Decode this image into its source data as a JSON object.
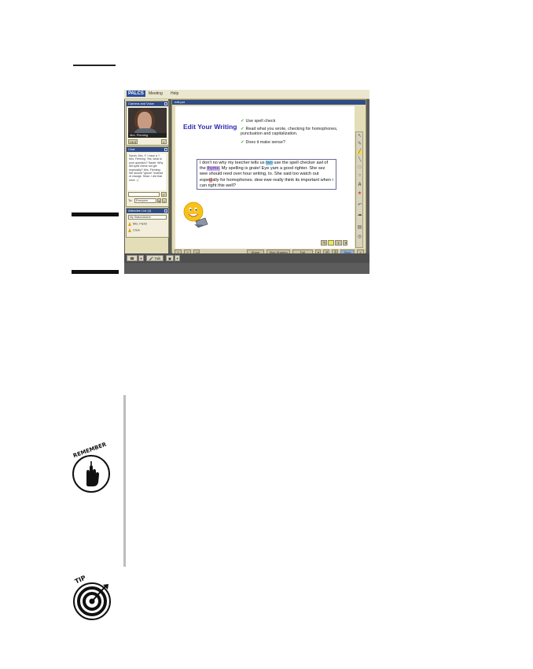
{
  "menu": {
    "logo": "PALCS",
    "items": [
      "Meeting",
      "Help"
    ]
  },
  "camera_panel": {
    "title": "Camera and Voice",
    "caption": "Mrs. Fleming",
    "btn": "Hit 8"
  },
  "chat_panel": {
    "title": "Chat",
    "messages": "Sarah: Mrs. F, I have a ? Mrs. Fleming: Yes, what is your question? Sarah: Why did spell check not get especially? Mrs. Fleming: We should \"ignore\" instead of change. Sean: I did that once :-)",
    "to_label": "To:",
    "to_value": "Everyone"
  },
  "attendee_panel": {
    "title": "Attendee List (4)",
    "select_value": "My Status/Active",
    "rows": [
      "Mrs. Flemi",
      "Crew"
    ]
  },
  "whiteboard": {
    "title": "edit.pst",
    "heading": "Edit Your Writing",
    "checklist": [
      "Use spell check",
      "Read what you wrote, checking for homophones, punctuation and capitalization.",
      "Does it make sense?"
    ],
    "sample": {
      "part1": "I don't no why my teecher tells us ",
      "hl1": "two",
      "part2": " use the spell checker awl of the ",
      "hl2": "thyme.",
      "part3": " My spelling is grate! Eye yam a good righter. She sez wee should reed over hour writing, to. She said too watch out espe",
      "hl3": "ci",
      "part4": "ally for homophones. dew ewe really think its important when i can right this well?"
    },
    "tool_labels": [
      "↖",
      "✎",
      "╱",
      "╲",
      "□",
      "○",
      "A",
      "★",
      "↶",
      "☁",
      "▤",
      "◎"
    ],
    "bottom_buttons": [
      "Share",
      "Stop Sharing",
      "Full Screen",
      "Sync"
    ],
    "page_value": "1"
  },
  "bottom_bar": {
    "talk": "Talk"
  },
  "badges": {
    "remember": "REMEMBER",
    "tip": "TIP"
  }
}
